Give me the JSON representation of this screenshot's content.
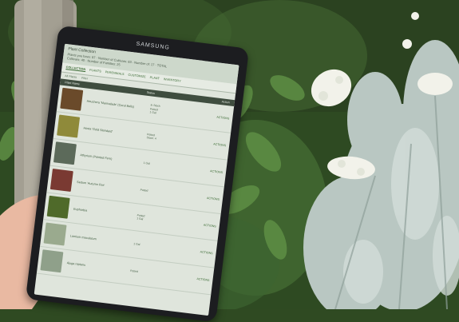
{
  "device": {
    "brand": "SAMSUNG"
  },
  "app": {
    "title": "Plant Collection",
    "header_lines": [
      "Plants you have: 97 · Number of Cultivars: 83 · Number of: 17 · TOTAL",
      "Cultivars: 40 · Number of Families: 25"
    ],
    "tabs": [
      {
        "label": "Collection",
        "active": true
      },
      {
        "label": "Plants",
        "active": false
      },
      {
        "label": "Perennials",
        "active": false
      },
      {
        "label": "Customize",
        "active": false
      },
      {
        "label": "Plant",
        "active": false
      },
      {
        "label": "Inventory",
        "active": false
      }
    ],
    "filters": [
      "All Plants",
      "Filter"
    ],
    "columns": [
      "Plant Name",
      "Status",
      "Action"
    ]
  },
  "plants": [
    {
      "name": "Heuchera 'Marmalade' (Coral Bells)",
      "status": [
        "In Stock",
        "Potted",
        "1 Gal"
      ],
      "action": "ACTIONS",
      "thumb_color": "#6a4a2a"
    },
    {
      "name": "Hosta 'Gold Standard'",
      "status": [
        "Potted",
        "Stock: 4"
      ],
      "action": "ACTIONS",
      "thumb_color": "#8f8a3a"
    },
    {
      "name": "Athyrium (Painted Fern)",
      "status": [
        "1 Gal"
      ],
      "action": "ACTIONS",
      "thumb_color": "#5c6a5a"
    },
    {
      "name": "Sedum 'Autumn Fire'",
      "status": [
        "Potted"
      ],
      "action": "ACTIONS",
      "thumb_color": "#7a3a32"
    },
    {
      "name": "Euphorbia",
      "status": [
        "Potted",
        "1 Gal"
      ],
      "action": "ACTIONS",
      "thumb_color": "#4f6a2a"
    },
    {
      "name": "Lamium maculatum",
      "status": [
        "1 Gal"
      ],
      "action": "ACTIONS",
      "thumb_color": "#9aaa8e"
    },
    {
      "name": "Ajuga reptans",
      "status": [
        "Potted"
      ],
      "action": "ACTIONS",
      "thumb_color": "#8fa08a"
    }
  ],
  "scene_colors": {
    "trunk": "#a39f92",
    "foliage_dark": "#2e4a22",
    "foliage_mid": "#4e7a3a",
    "silver_plant": "#b9c7c2",
    "flower": "#f2f2ea",
    "hand": "#e9b9a2"
  }
}
